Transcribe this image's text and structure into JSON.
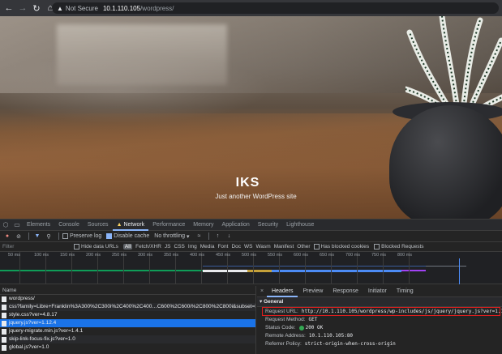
{
  "browser": {
    "security_label": "Not Secure",
    "url_host": "10.1.110.105",
    "url_path": "/wordpress/"
  },
  "site": {
    "title": "IKS",
    "tagline": "Just another WordPress site"
  },
  "devtools": {
    "tabs": [
      "Elements",
      "Console",
      "Sources",
      "Network",
      "Performance",
      "Memory",
      "Application",
      "Security",
      "Lighthouse"
    ],
    "active_tab": "Network",
    "toolbar": {
      "preserve_log": "Preserve log",
      "disable_cache": "Disable cache",
      "throttling": "No throttling"
    },
    "filter": {
      "placeholder": "Filter",
      "hide_data_urls": "Hide data URLs",
      "types": [
        "All",
        "Fetch/XHR",
        "JS",
        "CSS",
        "Img",
        "Media",
        "Font",
        "Doc",
        "WS",
        "Wasm",
        "Manifest",
        "Other"
      ],
      "has_blocked_cookies": "Has blocked cookies",
      "blocked_requests": "Blocked Requests"
    },
    "timeline_ticks": [
      "50 ms",
      "100 ms",
      "150 ms",
      "200 ms",
      "250 ms",
      "300 ms",
      "350 ms",
      "400 ms",
      "450 ms",
      "500 ms",
      "550 ms",
      "600 ms",
      "650 ms",
      "700 ms",
      "750 ms",
      "800 ms"
    ],
    "requests": {
      "column_name": "Name",
      "rows": [
        "wordpress/",
        "css?family=Libre+Franklin%3A300%2C300i%2C400%2C400…C600%2C600i%2C800%2C800i&subset=latin...",
        "style.css?ver=4.8.17",
        "jquery.js?ver=1.12.4",
        "jquery-migrate.min.js?ver=1.4.1",
        "skip-link-focus-fix.js?ver=1.0",
        "global.js?ver=1.0"
      ],
      "selected_index": 3
    },
    "details": {
      "tabs": [
        "Headers",
        "Preview",
        "Response",
        "Initiator",
        "Timing"
      ],
      "active_tab": "Headers",
      "section": "General",
      "request_url_label": "Request URL:",
      "request_url": "http://10.1.110.105/wordpress/wp-includes/js/jquery/jquery.js?ver=1.12.4",
      "request_method_label": "Request Method:",
      "request_method": "GET",
      "status_code_label": "Status Code:",
      "status_code": "200 OK",
      "remote_address_label": "Remote Address:",
      "remote_address": "10.1.110.105:80",
      "referrer_policy_label": "Referrer Policy:",
      "referrer_policy": "strict-origin-when-cross-origin"
    }
  }
}
